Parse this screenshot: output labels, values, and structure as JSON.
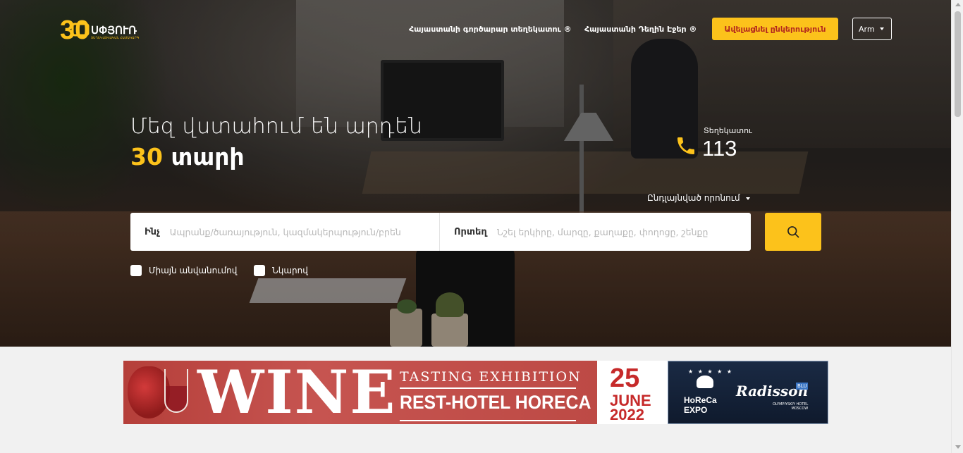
{
  "header": {
    "logo": {
      "number": "30",
      "brand": "ՍՓՅՈՒՌ",
      "tagline": "ՏԵՂԵԿԱՏՎԱԿԱՆ ՀԱՄԱԿԱՐԳ"
    },
    "nav": [
      {
        "label": "Հայաստանի գործարար տեղեկատու ®"
      },
      {
        "label": "Հայաստանի Դեղին Էջեր ®"
      }
    ],
    "add_company_label": "Ավելացնել ընկերություն",
    "language": "Arm"
  },
  "hero": {
    "headline_line1": "Մեզ վստահում են արդեն",
    "headline_number": "30",
    "headline_word": "տարի",
    "phone_label": "Տեղեկատու",
    "phone_number": "113",
    "advanced_search_label": "Ընդլայնված որոնում"
  },
  "search": {
    "what_label": "Ինչ",
    "what_placeholder": "Ապրանք/ծառայություն, կազմակերպություն/բրեն",
    "where_label": "Որտեղ",
    "where_placeholder": "Նշել երկիրը, մարզը, քաղաքը, փողոցը, շենքը"
  },
  "filters": [
    {
      "label": "Միայն անվանումով",
      "checked": false
    },
    {
      "label": "Նկարով",
      "checked": false
    }
  ],
  "banner": {
    "word": "WINE",
    "subtitle_top": "TASTING EXHIBITION",
    "subtitle_bottom": "REST-HOTEL HORECA",
    "date_day": "25",
    "date_month": "JUNE",
    "date_year": "2022",
    "expo_name_line1": "HoReCa",
    "expo_name_line2": "EXPO",
    "hotel_brand": "Radisson",
    "hotel_badge": "BLU",
    "hotel_sub_line1": "OLYMPIYSKIY HOTEL",
    "hotel_sub_line2": "MOSCOW"
  },
  "colors": {
    "accent": "#fcc21b",
    "accent_text": "#b3261e",
    "banner_red": "#c65450"
  }
}
